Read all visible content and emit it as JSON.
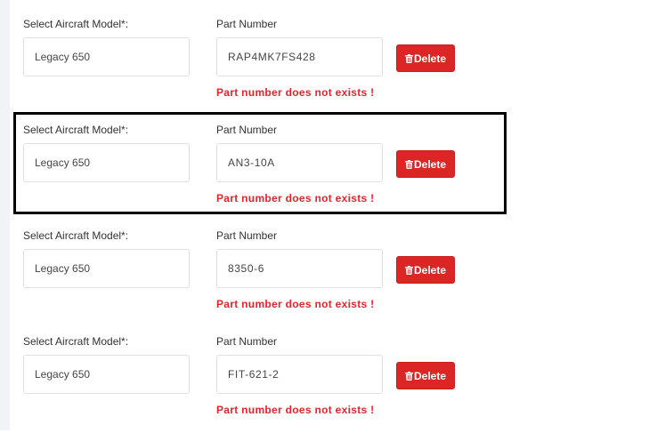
{
  "colors": {
    "delete_button": "#dc2626",
    "error_text": "#e3242b",
    "highlight_border": "#000000"
  },
  "rows": [
    {
      "model_label": "Select Aircraft Model*:",
      "model_value": "Legacy 650",
      "part_label": "Part Number",
      "part_value": "RAP4MK7FS428",
      "delete_label": "Delete",
      "delete_icon": "trash-icon",
      "error": "Part number does not exists !"
    },
    {
      "model_label": "Select Aircraft Model*:",
      "model_value": "Legacy 650",
      "part_label": "Part Number",
      "part_value": "AN3-10A",
      "delete_label": "Delete",
      "delete_icon": "trash-icon",
      "error": "Part number does not exists !"
    },
    {
      "model_label": "Select Aircraft Model*:",
      "model_value": "Legacy 650",
      "part_label": "Part Number",
      "part_value": "8350-6",
      "delete_label": "Delete",
      "delete_icon": "trash-icon",
      "error": "Part number does not exists !"
    },
    {
      "model_label": "Select Aircraft Model*:",
      "model_value": "Legacy 650",
      "part_label": "Part Number",
      "part_value": "FIT-621-2",
      "delete_label": "Delete",
      "delete_icon": "trash-icon",
      "error": "Part number does not exists !"
    }
  ]
}
